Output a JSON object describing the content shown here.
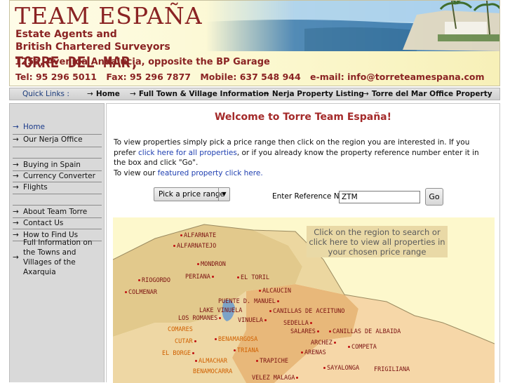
{
  "header": {
    "title": "TEAM ESPAÑA",
    "subtitle_1": "Estate Agents and",
    "subtitle_2": "British Chartered Surveyors",
    "office_town": "TORRE DEL MAR,",
    "office_address": "125a, Avenida Andalucia, opposite the BP Garage",
    "tel": "Tel: 95 296 5011",
    "fax": "Fax: 95 296 7877",
    "mobile": "Mobile: 637 548 944",
    "email": "e-mail: info@torreteamespana.com"
  },
  "quick_links": {
    "label": "Quick Links :",
    "arrow": "→",
    "items": [
      {
        "label": "Home"
      },
      {
        "label": "Full Town & Village Information"
      },
      {
        "label": "Nerja Property Listing"
      },
      {
        "label": "Torre del Mar Office Property"
      }
    ]
  },
  "sidebar": {
    "arrow": "→",
    "items": [
      {
        "label": "Home"
      },
      {
        "label": "Our Nerja Office"
      },
      {
        "label": "Buying in Spain"
      },
      {
        "label": "Currency Converter"
      },
      {
        "label": "Flights"
      },
      {
        "label": "About Team Torre"
      },
      {
        "label": "Contact Us"
      },
      {
        "label": "How to Find Us"
      },
      {
        "label": "Full Information on the Towns and Villages of the Axarquia"
      }
    ]
  },
  "main": {
    "welcome": "Welcome to Torre Team España!",
    "intro_1": "To view properties simply pick a price range then click on the region you are interested in. If you prefer",
    "intro_link_all": "click here for all properties",
    "intro_2": ", or if you already know the property reference number enter it in the box and click \"Go\".",
    "intro_3": "To view our",
    "intro_link_featured": "featured property click here.",
    "price_select": "Pick a price range",
    "ref_label": "Enter Reference No.",
    "ref_value": "ZTM",
    "go_label": "Go",
    "map_hint": "Click on the region to search or click here to view all properties in your chosen price range"
  },
  "map": {
    "towns": [
      {
        "name": "ALFARNATE",
        "tone": "dark"
      },
      {
        "name": "ALFARNATEJO",
        "tone": "dark"
      },
      {
        "name": "MONDRON",
        "tone": "dark"
      },
      {
        "name": "RIOGORDO",
        "tone": "dark"
      },
      {
        "name": "PERIANA",
        "tone": "dark"
      },
      {
        "name": "EL TORIL",
        "tone": "dark"
      },
      {
        "name": "COLMENAR",
        "tone": "dark"
      },
      {
        "name": "ALCAUCIN",
        "tone": "dark"
      },
      {
        "name": "PUENTE D. MANUEL",
        "tone": "dark"
      },
      {
        "name": "LAKE VINUELA",
        "tone": "dark"
      },
      {
        "name": "CANILLAS DE ACEITUNO",
        "tone": "dark"
      },
      {
        "name": "LOS ROMANES",
        "tone": "dark"
      },
      {
        "name": "VINUELA",
        "tone": "dark"
      },
      {
        "name": "SEDELLA",
        "tone": "dark"
      },
      {
        "name": "COMARES",
        "tone": "orange"
      },
      {
        "name": "SALARES",
        "tone": "dark"
      },
      {
        "name": "CANILLAS DE ALBAIDA",
        "tone": "dark"
      },
      {
        "name": "CUTAR",
        "tone": "orange"
      },
      {
        "name": "BENAMARGOSA",
        "tone": "orange"
      },
      {
        "name": "ARCHEZ",
        "tone": "dark"
      },
      {
        "name": "COMPETA",
        "tone": "dark"
      },
      {
        "name": "TRIANA",
        "tone": "orange"
      },
      {
        "name": "EL BORGE",
        "tone": "orange"
      },
      {
        "name": "ARENAS",
        "tone": "dark"
      },
      {
        "name": "ALMACHAR",
        "tone": "orange"
      },
      {
        "name": "TRAPICHE",
        "tone": "dark"
      },
      {
        "name": "SAYALONGA",
        "tone": "dark"
      },
      {
        "name": "BENAMOCARRA",
        "tone": "orange"
      },
      {
        "name": "FRIGILIANA",
        "tone": "dark"
      },
      {
        "name": "VELEZ MALAGA",
        "tone": "dark"
      }
    ]
  },
  "colors": {
    "brand": "#8a2323",
    "link": "#1f3fb0",
    "welcome": "#a42a2a",
    "sidebar_bg": "#d9d9d9",
    "map_bg": "#fdf8cc"
  }
}
